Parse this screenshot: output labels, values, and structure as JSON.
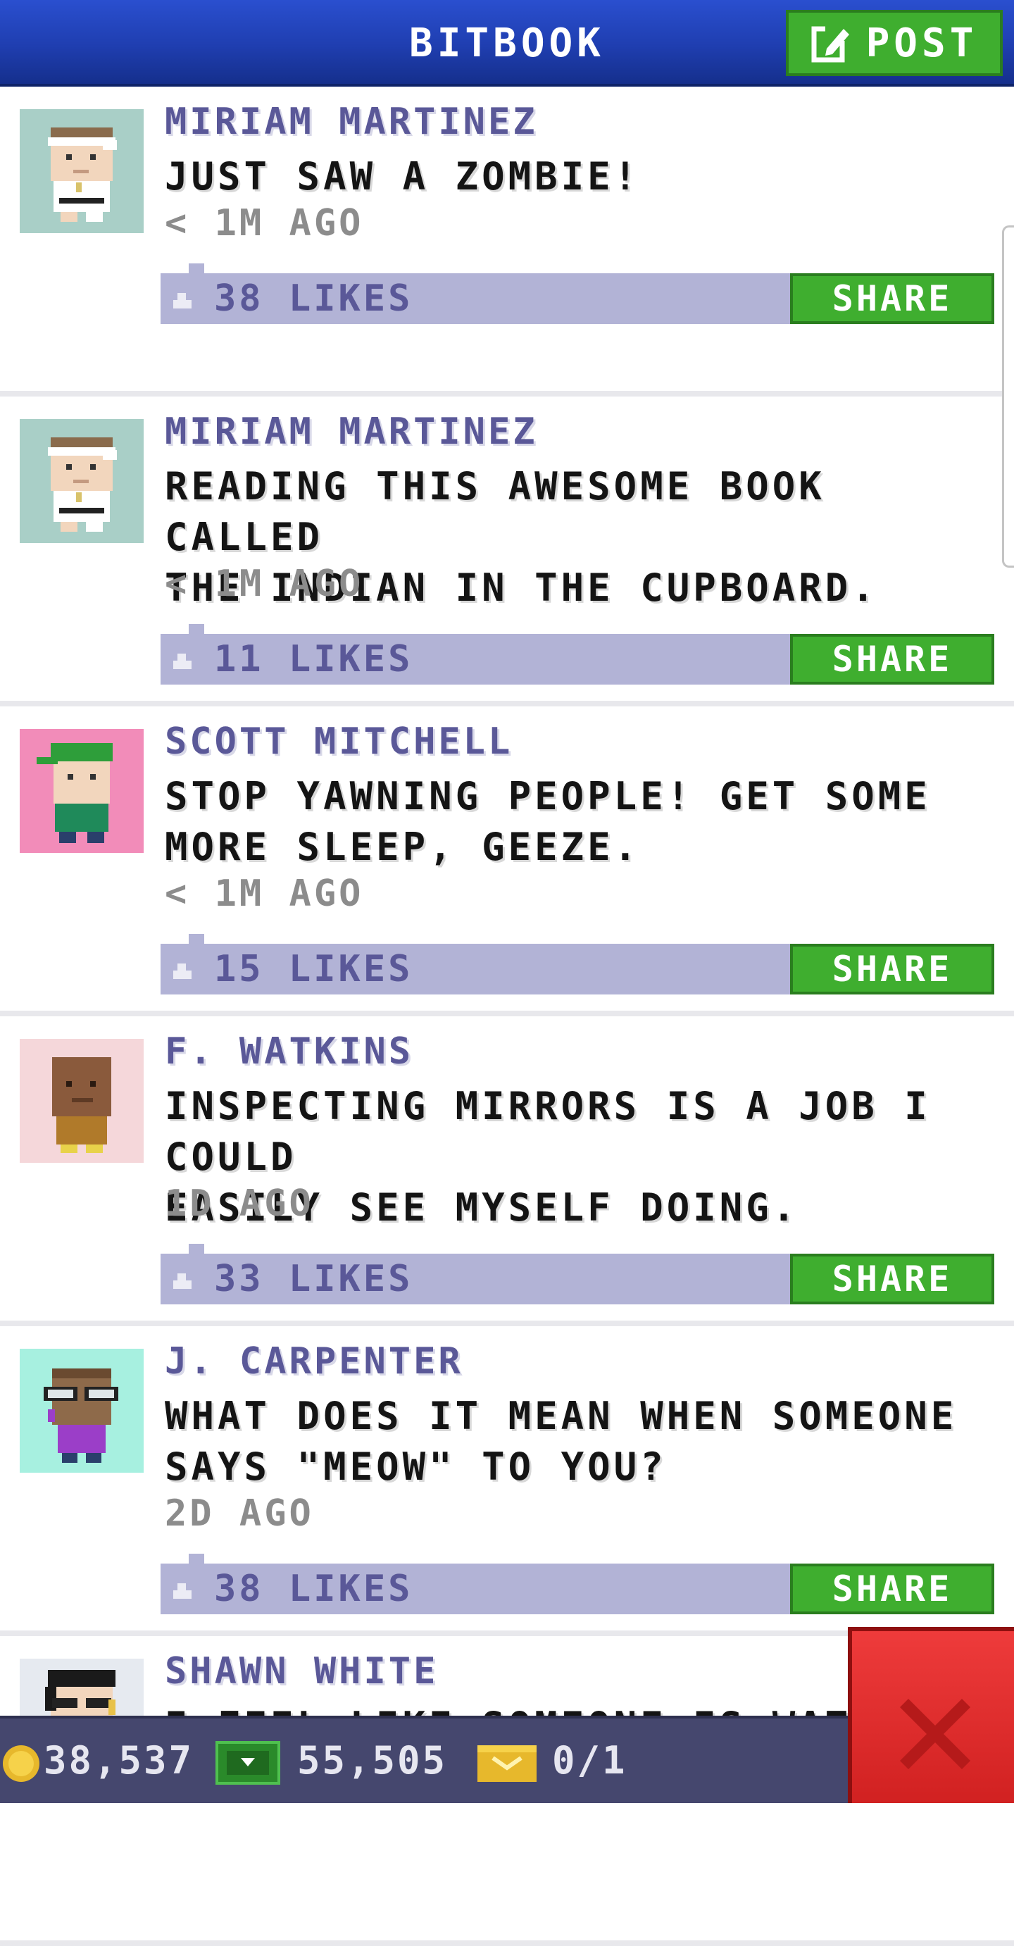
{
  "header": {
    "title": "BITBOOK",
    "post_label": "POST"
  },
  "feed": [
    {
      "author": "MIRIAM MARTINEZ",
      "message": "JUST SAW A ZOMBIE!",
      "time": "< 1M AGO",
      "likes": "38 LIKES",
      "share_label": "SHARE"
    },
    {
      "author": "MIRIAM MARTINEZ",
      "message": "READING THIS AWESOME BOOK CALLED\nTHE INDIAN IN THE CUPBOARD.",
      "time": "< 1M AGO",
      "likes": "11 LIKES",
      "share_label": "SHARE"
    },
    {
      "author": "SCOTT MITCHELL",
      "message": "STOP YAWNING PEOPLE! GET SOME\nMORE SLEEP, GEEZE.",
      "time": "< 1M AGO",
      "likes": "15 LIKES",
      "share_label": "SHARE"
    },
    {
      "author": "F. WATKINS",
      "message": "INSPECTING MIRRORS IS A JOB I COULD\nEASILY SEE MYSELF DOING.",
      "time": "1D AGO",
      "likes": "33 LIKES",
      "share_label": "SHARE"
    },
    {
      "author": "J. CARPENTER",
      "message": "WHAT DOES IT MEAN WHEN SOMEONE\nSAYS \"MEOW\" TO YOU?",
      "time": "2D AGO",
      "likes": "38 LIKES",
      "share_label": "SHARE"
    },
    {
      "author": "SHAWN WHITE",
      "message": "I FEEL LIKE SOMEONE IS WATCHIN",
      "time": "",
      "likes": "",
      "share_label": ""
    }
  ],
  "status_bar": {
    "coins": "38,537",
    "bux": "55,505",
    "tickets": "0/1"
  },
  "colors": {
    "header": "#1f3eb0",
    "button_green": "#3fae2f",
    "likes_bar": "#b2b3d6",
    "author_text": "#5a5898",
    "close_red": "#d12121",
    "bottom_bar": "#45476e"
  },
  "icons": {
    "post": "edit-icon",
    "like": "thumb-icon",
    "coin": "coin-icon",
    "bux": "bux-icon",
    "ticket": "ticket-icon",
    "close": "close-icon"
  }
}
